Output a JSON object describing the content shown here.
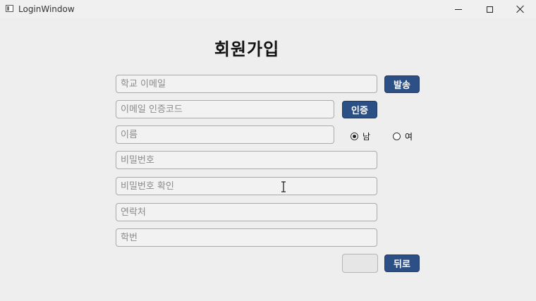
{
  "window": {
    "title": "LoginWindow"
  },
  "page": {
    "title": "회원가입"
  },
  "fields": {
    "school_email": {
      "placeholder": "학교 이메일",
      "value": ""
    },
    "email_code": {
      "placeholder": "이메일 인증코드",
      "value": ""
    },
    "name": {
      "placeholder": "이름",
      "value": ""
    },
    "password": {
      "placeholder": "비밀번호",
      "value": ""
    },
    "password_confirm": {
      "placeholder": "비밀번호 확인",
      "value": ""
    },
    "contact": {
      "placeholder": "연락처",
      "value": ""
    },
    "student_id": {
      "placeholder": "학번",
      "value": ""
    }
  },
  "buttons": {
    "send": "발송",
    "verify": "인증",
    "back": "뒤로",
    "blank": ""
  },
  "gender": {
    "options": [
      {
        "label": "남",
        "selected": true
      },
      {
        "label": "여",
        "selected": false
      }
    ]
  },
  "colors": {
    "accent": "#2c4f85",
    "background": "#eeeeee"
  }
}
